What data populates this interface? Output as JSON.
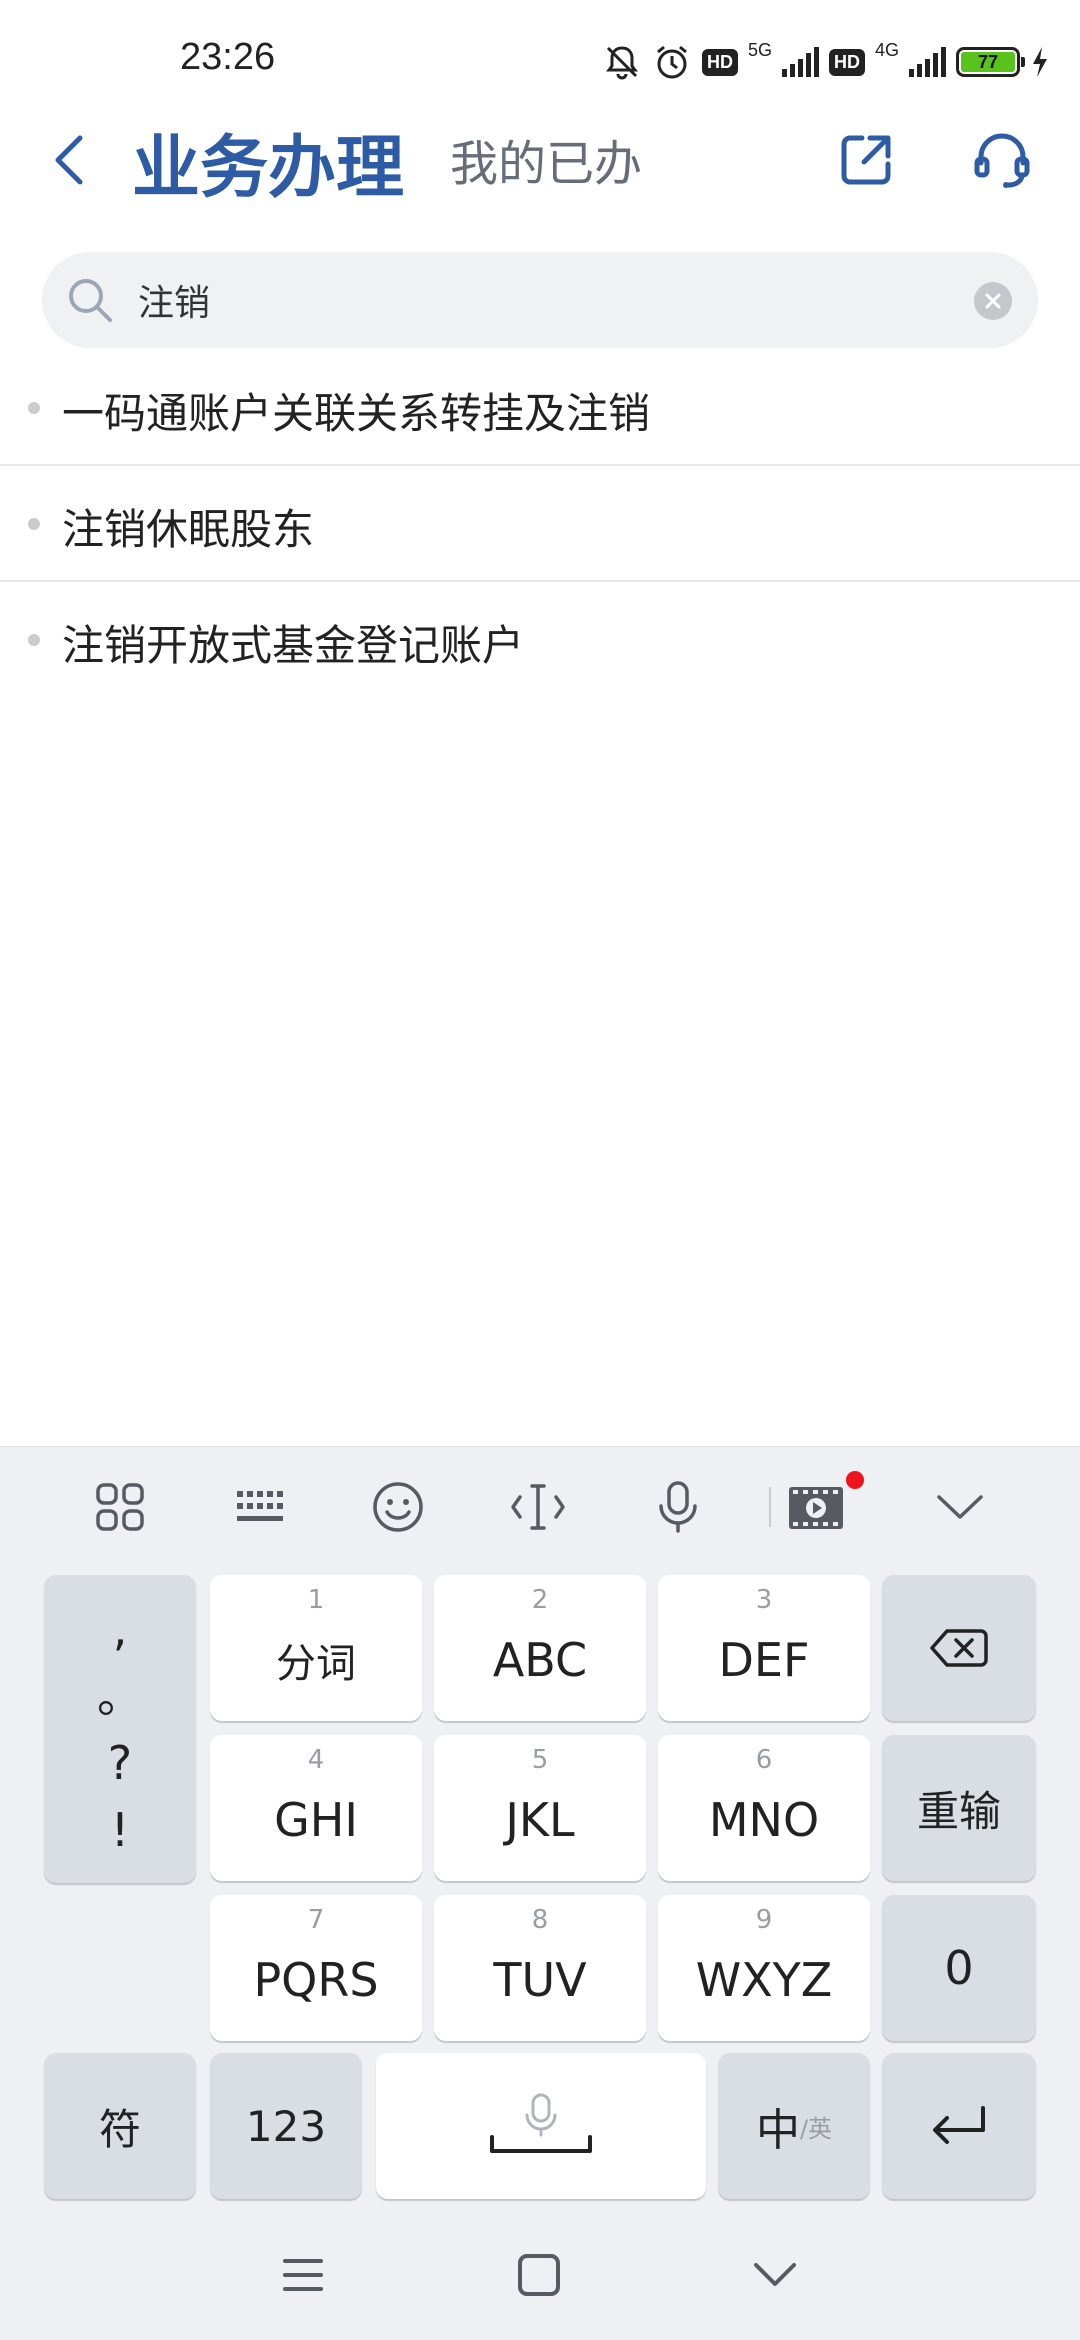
{
  "status_bar": {
    "time": "23:26",
    "net1": "5G",
    "net2": "4G",
    "hd": "HD",
    "battery": "77"
  },
  "header": {
    "title": "业务办理",
    "tab2": "我的已办"
  },
  "search": {
    "value": "注销"
  },
  "results": [
    "一码通账户关联关系转挂及注销",
    "注销休眠股东",
    "注销开放式基金登记账户"
  ],
  "keyboard": {
    "punct": [
      ",",
      "。",
      "?",
      "!"
    ],
    "keys": [
      {
        "num": "1",
        "label": "分词"
      },
      {
        "num": "2",
        "label": "ABC"
      },
      {
        "num": "3",
        "label": "DEF"
      },
      {
        "num": "4",
        "label": "GHI"
      },
      {
        "num": "5",
        "label": "JKL"
      },
      {
        "num": "6",
        "label": "MNO"
      },
      {
        "num": "7",
        "label": "PQRS"
      },
      {
        "num": "8",
        "label": "TUV"
      },
      {
        "num": "9",
        "label": "WXYZ"
      }
    ],
    "reenter": "重输",
    "zero": "0",
    "symbols": "符",
    "numbers": "123",
    "lang_main": "中",
    "lang_sub": "/英"
  },
  "colors": {
    "accent": "#2d5ba6",
    "keyboard_bg": "#eef0f4",
    "notification_dot": "#f0131e"
  }
}
